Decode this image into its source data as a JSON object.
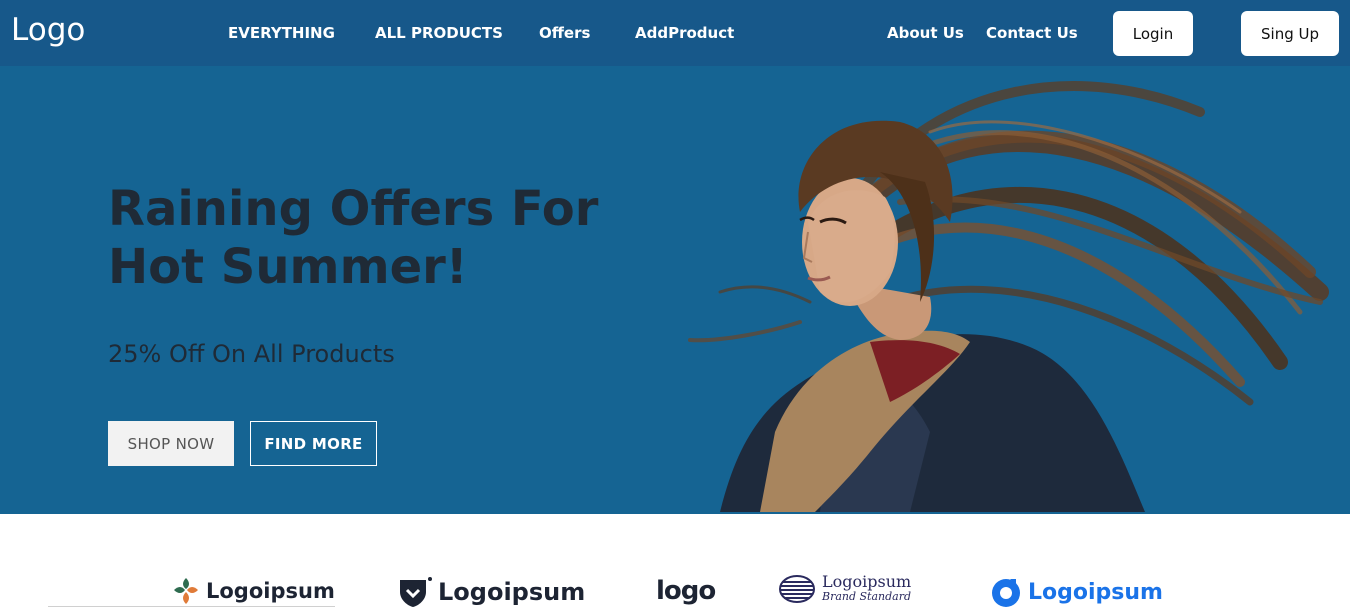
{
  "nav": {
    "logo": "Logo",
    "links": [
      "EVERYTHING",
      "ALL PRODUCTS",
      "Offers",
      "AddProduct",
      "About Us",
      "Contact Us"
    ],
    "login": "Login",
    "signup": "Sing Up"
  },
  "hero": {
    "title": "Raining Offers For Hot Summer!",
    "subtitle": "25% Off On All Products",
    "shop_button": "SHOP NOW",
    "find_button": "FIND MORE"
  },
  "brands": [
    {
      "name": "Logoipsum",
      "icon": "clover-logo-icon"
    },
    {
      "name": "Logoipsum",
      "icon": "shield-logo-icon"
    },
    {
      "name": "logo",
      "icon": "logo-wordmark-icon"
    },
    {
      "name": "Logoipsum",
      "tagline": "Brand Standard",
      "icon": "sphere-logo-icon"
    },
    {
      "name": "Logoipsum",
      "icon": "blue-badge-logo-icon"
    }
  ],
  "colors": {
    "nav_bg": "#17588a",
    "hero_bg": "#156493",
    "title_text": "#1f2a36",
    "accent_blue": "#1a73e8"
  }
}
